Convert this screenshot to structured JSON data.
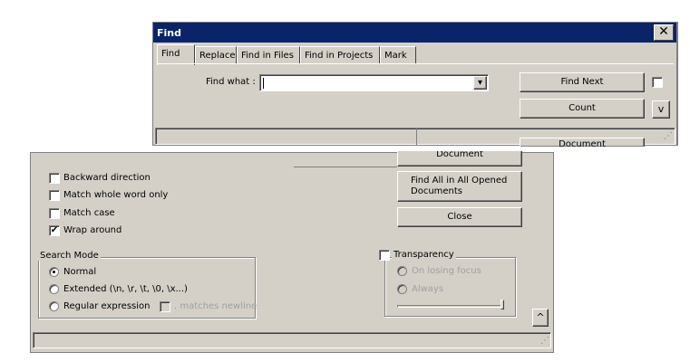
{
  "top_window": {
    "title": "Find",
    "close_symbol": "✕",
    "tabs": [
      "Find",
      "Replace",
      "Find in Files",
      "Find in Projects",
      "Mark"
    ],
    "find_what_label": "Find what :",
    "find_what_value": "",
    "dropdown_arrow": "▾",
    "find_next_label": "Find Next",
    "count_label": "Count",
    "expand_symbol": "v",
    "partial_button_label": "Document"
  },
  "bottom_window": {
    "partial_button_label": "Document",
    "find_all_label": "Find All in All Opened Documents",
    "close_label": "Close",
    "options": [
      {
        "label": "Backward direction",
        "checked": false
      },
      {
        "label": "Match whole word only",
        "checked": false
      },
      {
        "label": "Match case",
        "checked": false
      },
      {
        "label": "Wrap around",
        "checked": true
      }
    ],
    "search_mode": {
      "title": "Search Mode",
      "normal": "Normal",
      "extended": "Extended (\\n, \\r, \\t, \\0, \\x...)",
      "regex": "Regular expression",
      "matches_newline": ". matches newline",
      "selected": "normal"
    },
    "transparency": {
      "title": "Transparency",
      "on_losing_focus": "On losing focus",
      "always": "Always"
    },
    "collapse_symbol": "^",
    "check_mark": "✔"
  }
}
